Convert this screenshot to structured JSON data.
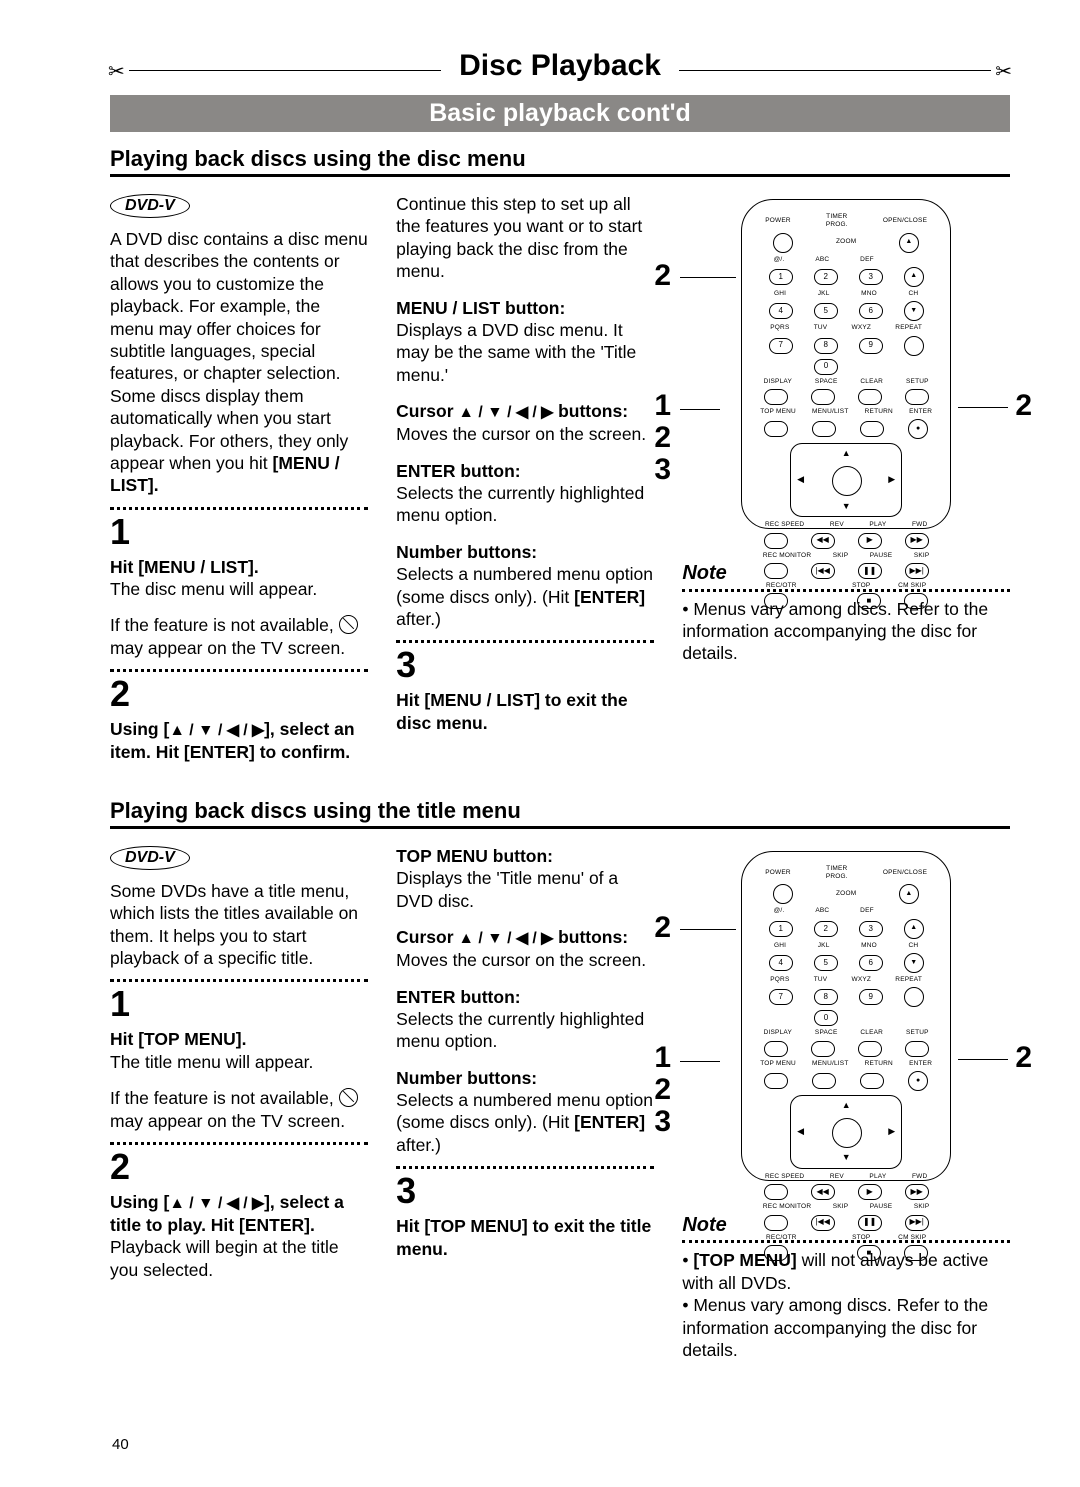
{
  "banner": {
    "title": "Disc Playback",
    "subbanner": "Basic playback cont'd"
  },
  "page_number": "40",
  "dvd_badge": "DVD-V",
  "disc_menu": {
    "heading": "Playing back discs using the disc menu",
    "intro": "A DVD disc contains a disc menu that describes the contents or allows you to customize the playback. For example, the menu may offer choices for subtitle languages, special features, or chapter selection.\nSome discs display them automatically when you start playback. For others, they only appear when you hit",
    "intro_bold_end": "MENU / LIST",
    "step1_num": "1",
    "step1_b": "Hit [MENU / LIST].",
    "step1_t": "The disc menu will appear.",
    "step1_na1": "If the feature is not available, ",
    "step1_na2": " may appear on the TV screen.",
    "step2_num": "2",
    "step2_b1": "Using [",
    "step2_b2": "], select an item. Hit [ENTER] to confirm.",
    "step2_t": "Continue this step to set up all the features you want or to start playing back the disc from the menu.",
    "defs": {
      "menu_list_h": "MENU / LIST button:",
      "menu_list_t": "Displays a DVD disc menu. It may be the same with the 'Title menu.'",
      "cursor_h1": "Cursor ",
      "cursor_h2": " buttons:",
      "cursor_t": "Moves the cursor on the screen.",
      "enter_h": "ENTER button:",
      "enter_t": "Selects the currently highlighted menu option.",
      "number_h": "Number buttons:",
      "number_t1": "Selects a numbered menu option (some discs only). (Hit ",
      "number_t2": "[ENTER]",
      "number_t3": " after.)"
    },
    "step3_num": "3",
    "step3_b": "Hit [MENU / LIST] to exit the disc menu.",
    "note_title": "Note",
    "note1": "Menus vary among discs. Refer to the information accompanying the disc for details."
  },
  "title_menu": {
    "heading": "Playing back discs using the title menu",
    "intro": "Some DVDs have a title menu, which lists the titles available on them. It helps you to start playback of a specific title.",
    "step1_num": "1",
    "step1_b": "Hit [TOP MENU].",
    "step1_t": "The title menu will appear.",
    "step1_na1": "If the feature is not available, ",
    "step1_na2": " may appear on the TV screen.",
    "step2_num": "2",
    "step2_b1": "Using [",
    "step2_b2": "], select a title to play. Hit [ENTER].",
    "step2_t": "Playback will begin at the title you selected.",
    "defs": {
      "top_h": "TOP MENU button:",
      "top_t": "Displays the 'Title menu' of a DVD disc.",
      "cursor_h1": "Cursor ",
      "cursor_h2": " buttons:",
      "cursor_t": "Moves the cursor on the screen.",
      "enter_h": "ENTER button:",
      "enter_t": "Selects the currently highlighted menu option.",
      "number_h": "Number buttons:",
      "number_t1": "Selects a numbered menu option (some discs only). (Hit ",
      "number_t2": "[ENTER]",
      "number_t3": " after.)"
    },
    "step3_num": "3",
    "step3_b": "Hit [TOP MENU] to exit the title menu.",
    "note_title": "Note",
    "note1a": "[TOP MENU]",
    "note1b": " will not always be active with all DVDs.",
    "note2": "Menus vary among discs. Refer to the information accompanying the disc for details."
  },
  "remote": {
    "row1": [
      "POWER",
      "TIMER PROG.",
      "OPEN/CLOSE"
    ],
    "row2": [
      "ZOOM"
    ],
    "digits_rowlabels": [
      [
        "@/.",
        "ABC",
        "DEF"
      ],
      [
        "GHI",
        "JKL",
        "MNO"
      ],
      [
        "PQRS",
        "TUV",
        "WXYZ"
      ]
    ],
    "digits_sidelabels": [
      "",
      "CH",
      "REPEAT"
    ],
    "digits": [
      [
        "1",
        "2",
        "3"
      ],
      [
        "4",
        "5",
        "6"
      ],
      [
        "7",
        "8",
        "9"
      ],
      [
        "",
        "0",
        ""
      ]
    ],
    "row_dscs": [
      "DISPLAY",
      "SPACE",
      "CLEAR",
      "SETUP"
    ],
    "row_menu": [
      "TOP MENU",
      "MENU/LIST",
      "RETURN",
      "ENTER"
    ],
    "row_play": [
      "REC SPEED",
      "REV",
      "PLAY",
      "FWD"
    ],
    "row_skip": [
      "REC MONITOR",
      "SKIP",
      "PAUSE",
      "SKIP"
    ],
    "row_rec": [
      "REC/OTR",
      "",
      "STOP",
      "CM SKIP"
    ],
    "callouts_left": [
      "2",
      "1",
      "2",
      "3"
    ],
    "callouts_right": [
      "2"
    ]
  }
}
